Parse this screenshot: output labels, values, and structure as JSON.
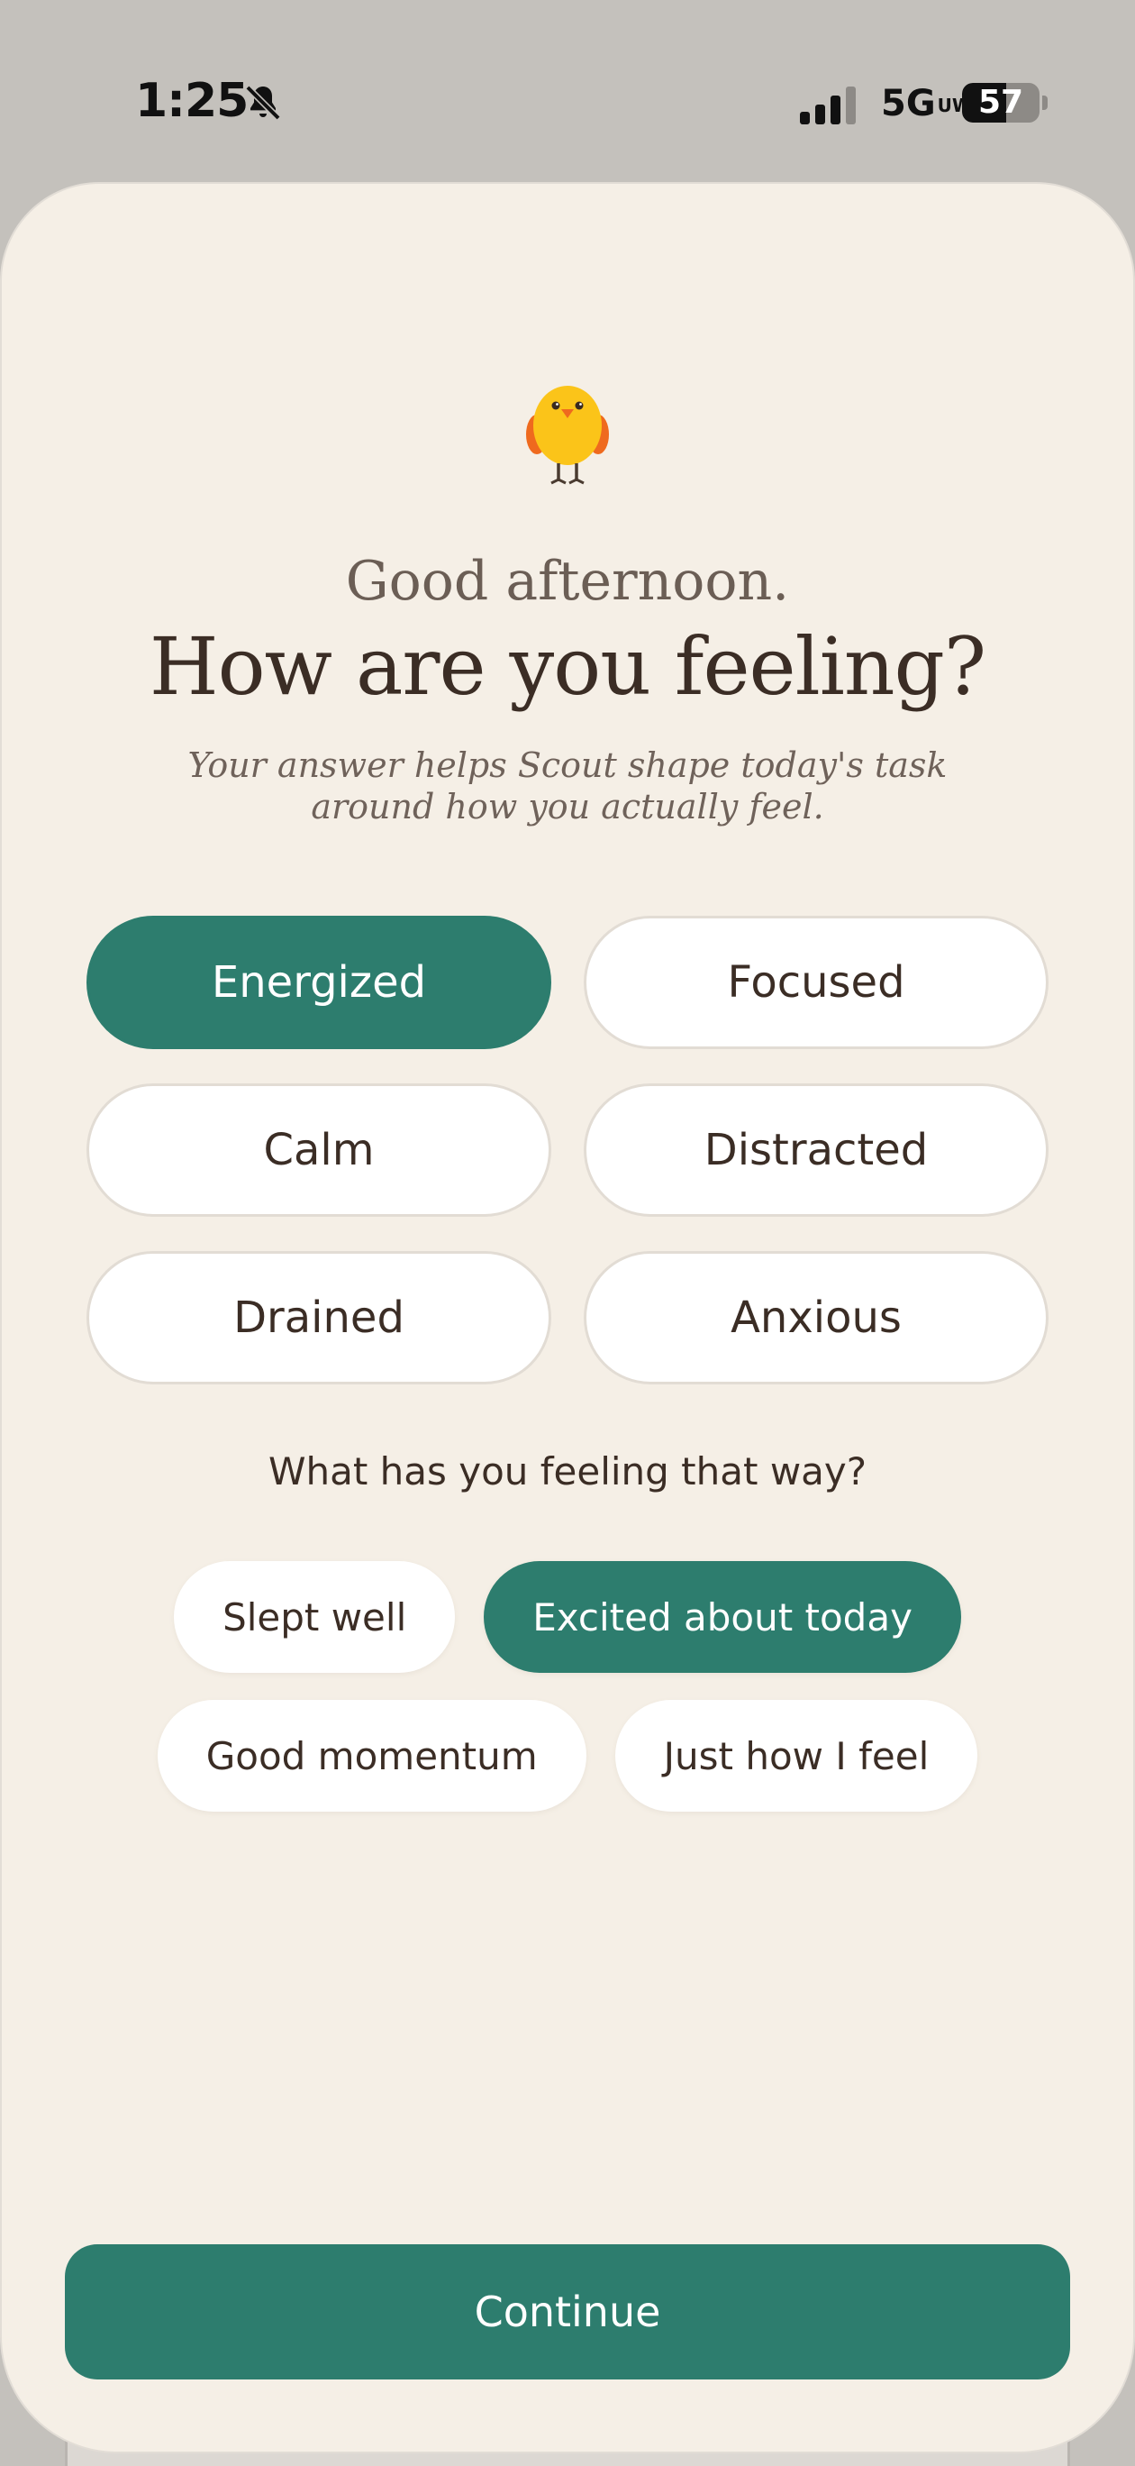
{
  "status_bar": {
    "time": "1:25",
    "network": "5G",
    "network_sub": "UW",
    "battery": "57",
    "battery_level": 0.57
  },
  "colors": {
    "accent": "#2d7d6e",
    "background": "#f5efe6",
    "text": "#3b2d25"
  },
  "header": {
    "mascot_icon": "chick-icon",
    "greeting": "Good afternoon.",
    "headline": "How are you feeling?",
    "subtitle": "Your answer helps Scout shape today's task around how you actually feel."
  },
  "moods": [
    {
      "label": "Energized",
      "selected": true
    },
    {
      "label": "Focused",
      "selected": false
    },
    {
      "label": "Calm",
      "selected": false
    },
    {
      "label": "Distracted",
      "selected": false
    },
    {
      "label": "Drained",
      "selected": false
    },
    {
      "label": "Anxious",
      "selected": false
    }
  ],
  "reasons": {
    "question": "What has you feeling that way?",
    "options": [
      {
        "label": "Slept well",
        "selected": false
      },
      {
        "label": "Excited about today",
        "selected": true
      },
      {
        "label": "Good momentum",
        "selected": false
      },
      {
        "label": "Just how I feel",
        "selected": false
      }
    ]
  },
  "continue_label": "Continue"
}
